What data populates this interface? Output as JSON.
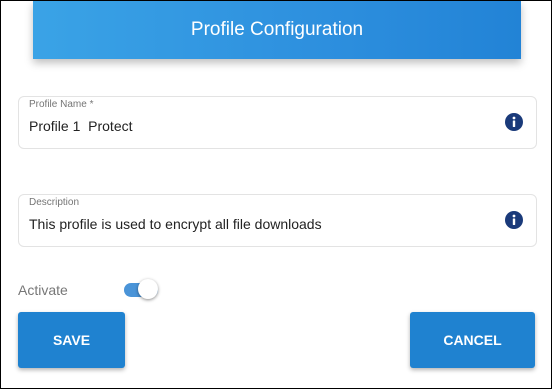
{
  "header": {
    "title": "Profile Configuration"
  },
  "fields": {
    "profile_name": {
      "label": "Profile Name *",
      "value": "Profile 1  Protect",
      "icon": "info-icon"
    },
    "description": {
      "label": "Description",
      "value": "This profile is used to encrypt all file downloads",
      "icon": "info-icon"
    }
  },
  "activate": {
    "label": "Activate",
    "enabled": true
  },
  "buttons": {
    "save_label": "SAVE",
    "cancel_label": "CANCEL"
  },
  "colors": {
    "accent": "#1f82d0",
    "info_icon": "#1a3a7a",
    "toggle_track": "#4a94d8"
  }
}
